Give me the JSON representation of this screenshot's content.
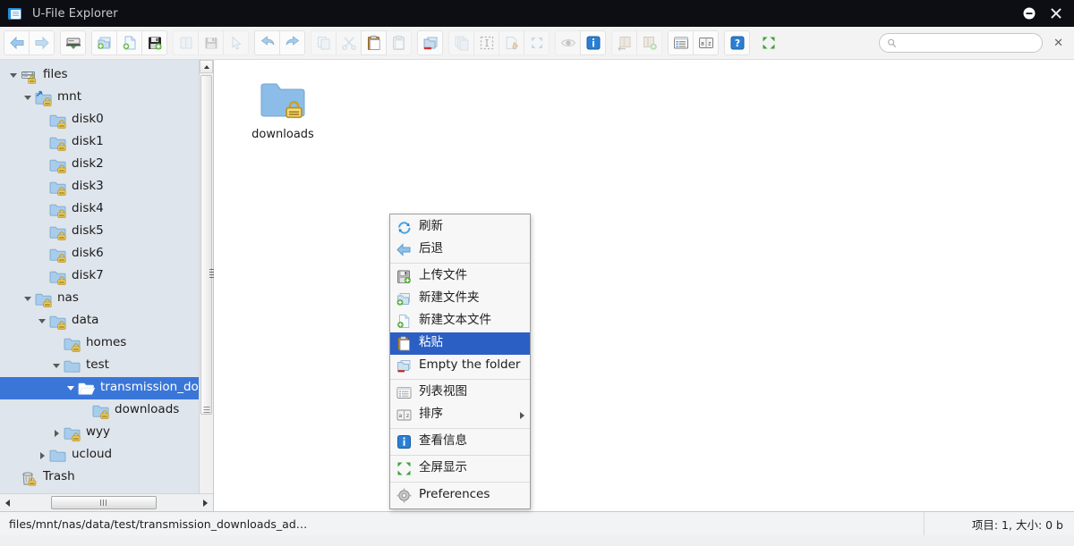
{
  "window": {
    "title": "U-File Explorer",
    "icon": "file-explorer-icon",
    "minimize_label": "–",
    "close_label": "✕"
  },
  "toolbar": {
    "close_label": "✕",
    "groups": [
      {
        "name": "navigation",
        "buttons": [
          {
            "name": "back-button",
            "icon": "arrow-left-icon",
            "enabled": true
          },
          {
            "name": "forward-button",
            "icon": "arrow-right-icon",
            "enabled": true
          }
        ]
      },
      {
        "name": "download",
        "buttons": [
          {
            "name": "download-button",
            "icon": "download-drive-icon",
            "enabled": true
          }
        ]
      },
      {
        "name": "create",
        "buttons": [
          {
            "name": "new-folder-button",
            "icon": "new-folder-icon",
            "enabled": true
          },
          {
            "name": "new-file-button",
            "icon": "new-file-icon",
            "enabled": true
          },
          {
            "name": "upload-file-button",
            "icon": "floppy-upload-icon",
            "enabled": true
          }
        ]
      },
      {
        "name": "file-ops",
        "buttons": [
          {
            "name": "open-button",
            "icon": "open-book-icon",
            "enabled": false
          },
          {
            "name": "save-button",
            "icon": "floppy-icon",
            "enabled": false
          },
          {
            "name": "select-button",
            "icon": "cursor-icon",
            "enabled": false
          }
        ]
      },
      {
        "name": "history",
        "buttons": [
          {
            "name": "undo-button",
            "icon": "undo-arrow-icon",
            "enabled": true
          },
          {
            "name": "redo-button",
            "icon": "redo-arrow-icon",
            "enabled": true
          }
        ]
      },
      {
        "name": "clipboard",
        "buttons": [
          {
            "name": "copy-button",
            "icon": "copy-pages-icon",
            "enabled": false
          },
          {
            "name": "cut-button",
            "icon": "scissors-icon",
            "enabled": false
          },
          {
            "name": "paste-button",
            "icon": "clipboard-icon",
            "enabled": true
          },
          {
            "name": "paste-special-button",
            "icon": "clipboard-blue-icon",
            "enabled": false
          }
        ]
      },
      {
        "name": "delete",
        "buttons": [
          {
            "name": "delete-button",
            "icon": "delete-folder-icon",
            "enabled": true
          }
        ]
      },
      {
        "name": "selection",
        "buttons": [
          {
            "name": "duplicate-button",
            "icon": "stack-pages-icon",
            "enabled": false
          },
          {
            "name": "select-all-button",
            "icon": "marquee-select-icon",
            "enabled": false
          },
          {
            "name": "rename-button",
            "icon": "rename-pencil-icon",
            "enabled": false
          },
          {
            "name": "fullscreen-button",
            "icon": "fullscreen-arrows-icon",
            "enabled": false
          }
        ]
      },
      {
        "name": "view-info",
        "buttons": [
          {
            "name": "preview-button",
            "icon": "eye-icon",
            "enabled": false
          },
          {
            "name": "info-button",
            "icon": "info-icon",
            "enabled": true
          }
        ]
      },
      {
        "name": "archive",
        "buttons": [
          {
            "name": "extract-button",
            "icon": "archive-extract-icon",
            "enabled": false
          },
          {
            "name": "compress-button",
            "icon": "archive-add-icon",
            "enabled": false
          }
        ]
      },
      {
        "name": "list-sort",
        "buttons": [
          {
            "name": "list-view-button",
            "icon": "list-view-icon",
            "enabled": true
          },
          {
            "name": "sort-button",
            "icon": "sort-az-icon",
            "enabled": true
          }
        ]
      },
      {
        "name": "help",
        "buttons": [
          {
            "name": "help-button",
            "icon": "question-mark-icon",
            "enabled": true
          }
        ]
      },
      {
        "name": "expand",
        "buttons": [
          {
            "name": "expand-button",
            "icon": "expand-arrows-green-icon",
            "enabled": true
          }
        ]
      }
    ]
  },
  "search": {
    "value": "",
    "placeholder": "",
    "icon": "search-icon"
  },
  "sidebar": {
    "tree": [
      {
        "label": "files",
        "indent": 0,
        "twisty": "open",
        "icon": "server-icon",
        "selected": false
      },
      {
        "label": "mnt",
        "indent": 1,
        "twisty": "open",
        "icon": "shortcut-folder-icon",
        "selected": false
      },
      {
        "label": "disk0",
        "indent": 2,
        "twisty": "none",
        "icon": "locked-folder-icon",
        "selected": false
      },
      {
        "label": "disk1",
        "indent": 2,
        "twisty": "none",
        "icon": "locked-folder-icon",
        "selected": false
      },
      {
        "label": "disk2",
        "indent": 2,
        "twisty": "none",
        "icon": "locked-folder-icon",
        "selected": false
      },
      {
        "label": "disk3",
        "indent": 2,
        "twisty": "none",
        "icon": "locked-folder-icon",
        "selected": false
      },
      {
        "label": "disk4",
        "indent": 2,
        "twisty": "none",
        "icon": "locked-folder-icon",
        "selected": false
      },
      {
        "label": "disk5",
        "indent": 2,
        "twisty": "none",
        "icon": "locked-folder-icon",
        "selected": false
      },
      {
        "label": "disk6",
        "indent": 2,
        "twisty": "none",
        "icon": "locked-folder-icon",
        "selected": false
      },
      {
        "label": "disk7",
        "indent": 2,
        "twisty": "none",
        "icon": "locked-folder-icon",
        "selected": false
      },
      {
        "label": "nas",
        "indent": 1,
        "twisty": "open",
        "icon": "locked-folder-icon",
        "selected": false
      },
      {
        "label": "data",
        "indent": 2,
        "twisty": "open",
        "icon": "locked-folder-icon",
        "selected": false
      },
      {
        "label": "homes",
        "indent": 3,
        "twisty": "none",
        "icon": "locked-folder-icon",
        "selected": false
      },
      {
        "label": "test",
        "indent": 3,
        "twisty": "open",
        "icon": "folder-icon",
        "selected": false
      },
      {
        "label": "transmission_downl",
        "indent": 4,
        "twisty": "open",
        "icon": "open-folder-icon",
        "selected": true
      },
      {
        "label": "downloads",
        "indent": 5,
        "twisty": "none",
        "icon": "locked-folder-icon",
        "selected": false
      },
      {
        "label": "wyy",
        "indent": 3,
        "twisty": "closed",
        "icon": "locked-folder-icon",
        "selected": false
      },
      {
        "label": "ucloud",
        "indent": 2,
        "twisty": "closed",
        "icon": "folder-icon",
        "selected": false
      },
      {
        "label": "Trash",
        "indent": 0,
        "twisty": "none",
        "icon": "trash-icon",
        "selected": false
      }
    ]
  },
  "content": {
    "items": [
      {
        "name": "downloads",
        "icon": "locked-folder-large-icon"
      }
    ]
  },
  "context_menu": {
    "items": [
      {
        "label": "刷新",
        "icon": "refresh-icon",
        "highlight": false,
        "submenu": false,
        "separator_after": false
      },
      {
        "label": "后退",
        "icon": "back-arrow-icon",
        "highlight": false,
        "submenu": false,
        "separator_after": true
      },
      {
        "label": "上传文件",
        "icon": "upload-floppy-icon",
        "highlight": false,
        "submenu": false,
        "separator_after": false
      },
      {
        "label": "新建文件夹",
        "icon": "new-folder-icon",
        "highlight": false,
        "submenu": false,
        "separator_after": false
      },
      {
        "label": "新建文本文件",
        "icon": "new-text-file-icon",
        "highlight": false,
        "submenu": false,
        "separator_after": false
      },
      {
        "label": "粘贴",
        "icon": "paste-clipboard-icon",
        "highlight": true,
        "submenu": false,
        "separator_after": false
      },
      {
        "label": "Empty the folder",
        "icon": "empty-folder-icon",
        "highlight": false,
        "submenu": false,
        "separator_after": true
      },
      {
        "label": "列表视图",
        "icon": "list-view-icon",
        "highlight": false,
        "submenu": false,
        "separator_after": false
      },
      {
        "label": "排序",
        "icon": "sort-az-icon",
        "highlight": false,
        "submenu": true,
        "separator_after": true
      },
      {
        "label": "查看信息",
        "icon": "info-icon",
        "highlight": false,
        "submenu": false,
        "separator_after": true
      },
      {
        "label": "全屏显示",
        "icon": "fullscreen-green-icon",
        "highlight": false,
        "submenu": false,
        "separator_after": true
      },
      {
        "label": "Preferences",
        "icon": "gear-icon",
        "highlight": false,
        "submenu": false,
        "separator_after": false
      }
    ]
  },
  "statusbar": {
    "path": "files/mnt/nas/data/test/transmission_downloads_ad…",
    "info": "项目: 1, 大小: 0 b"
  },
  "colors": {
    "titlebar_bg": "#0d0d14",
    "toolbar_bg": "#f3f3f3",
    "sidebar_bg": "#dfe5ec",
    "selection_blue": "#3a76d8",
    "menu_highlight": "#2b5fc4",
    "folder_blue": "#7cb1e3"
  }
}
